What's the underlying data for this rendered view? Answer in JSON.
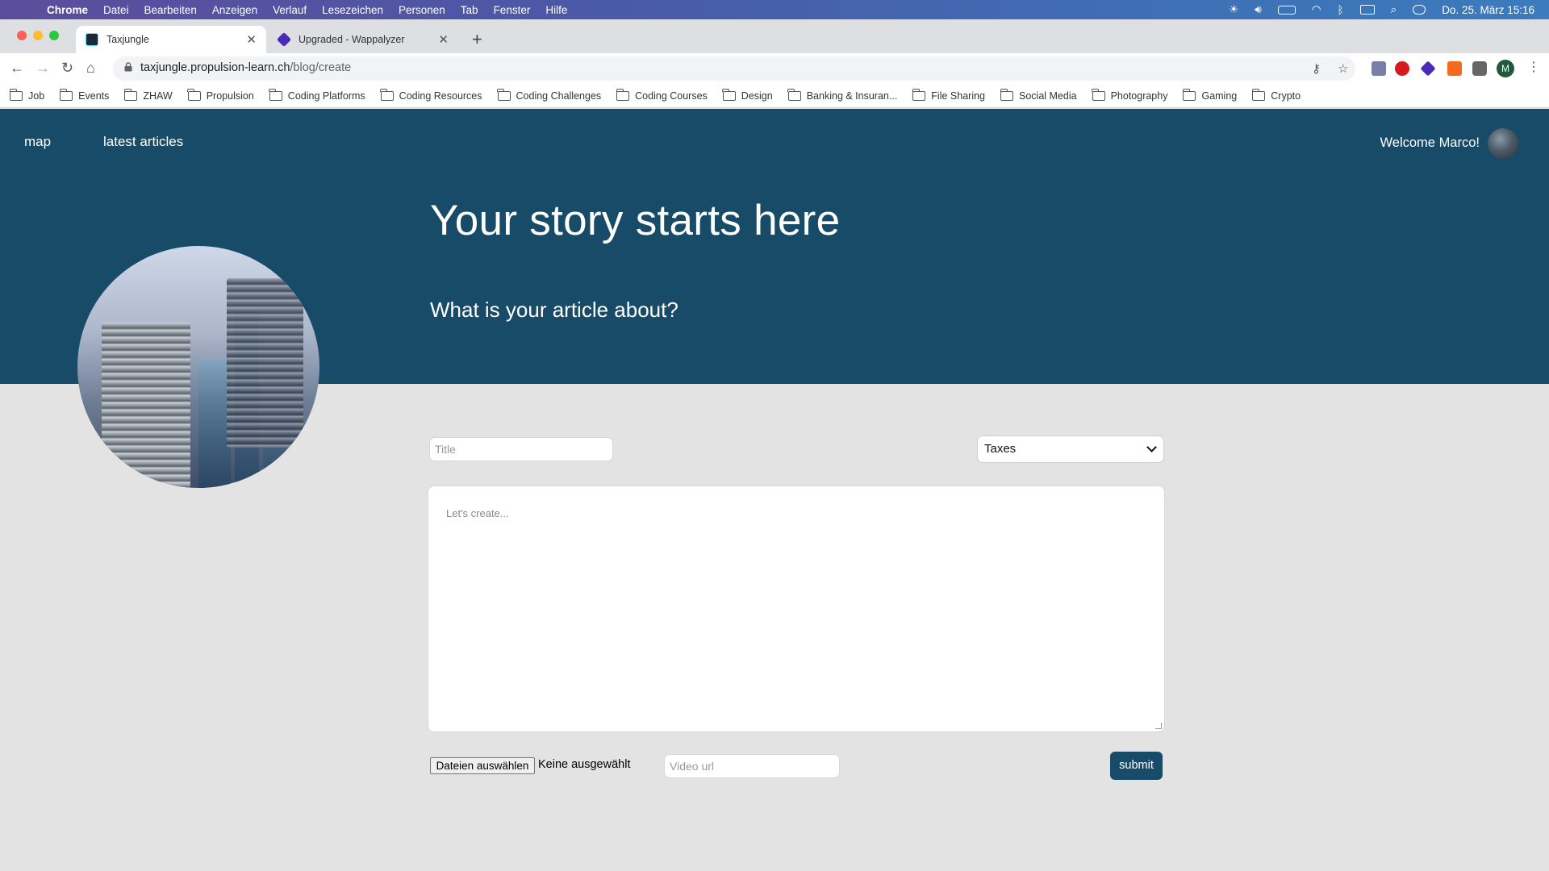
{
  "menubar": {
    "app_name": "Chrome",
    "items": [
      "Datei",
      "Bearbeiten",
      "Anzeigen",
      "Verlauf",
      "Lesezeichen",
      "Personen",
      "Tab",
      "Fenster",
      "Hilfe"
    ],
    "clock": "Do. 25. März  15:16"
  },
  "tabs": [
    {
      "title": "Taxjungle",
      "active": true
    },
    {
      "title": "Upgraded - Wappalyzer",
      "active": false
    }
  ],
  "address": {
    "domain": "taxjungle.propulsion-learn.ch",
    "path": "/blog/create"
  },
  "profile_initial": "M",
  "bookmarks": [
    "Job",
    "Events",
    "ZHAW",
    "Propulsion",
    "Coding Platforms",
    "Coding Resources",
    "Coding Challenges",
    "Coding Courses",
    "Design",
    "Banking & Insuran...",
    "File Sharing",
    "Social Media",
    "Photography",
    "Gaming",
    "Crypto"
  ],
  "site": {
    "nav": {
      "map": "map",
      "latest": "latest articles"
    },
    "welcome": "Welcome Marco!",
    "hero_title": "Your story starts here",
    "hero_subtitle": "What is your article about?",
    "colors": {
      "primary": "#174b67",
      "background": "#e3e3e3"
    }
  },
  "form": {
    "title_placeholder": "Title",
    "category_selected": "Taxes",
    "content_placeholder": "Let's create...",
    "file_button": "Dateien auswählen",
    "file_status": "Keine ausgewählt",
    "video_placeholder": "Video url",
    "submit": "submit"
  }
}
